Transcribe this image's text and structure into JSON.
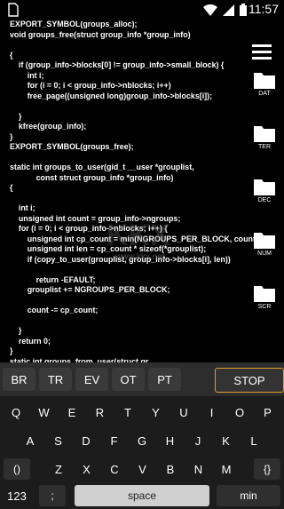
{
  "status": {
    "time": "11:57"
  },
  "code_lines": [
    "EXPORT_SYMBOL(groups_alloc);",
    "void groups_free(struct group_info *group_info)",
    "",
    "{",
    "    if (group_info->blocks[0] != group_info->small_block) {",
    "        int i;",
    "        for (i = 0; i < group_info->nblocks; i++)",
    "        free_page((unsigned long)group_info->blocks[i]);",
    "",
    "    }",
    "    kfree(group_info);",
    "}",
    "EXPORT_SYMBOL(groups_free);",
    "",
    "static int groups_to_user(gid_t __user *grouplist,",
    "            const struct group_info *group_info)",
    "{",
    "",
    "    int i;",
    "    unsigned int count = group_info->ngroups;",
    "    for (i = 0; i < group_info->nblocks; i++) {",
    "        unsigned int cp_count = min(NGROUPS_PER_BLOCK, count);",
    "        unsigned int len = cp_count * sizeof(*grouplist);",
    "        if (copy_to_user(grouplist, group_info->blocks[i], len))",
    "",
    "            return -EFAULT;",
    "        grouplist += NGROUPS_PER_BLOCK;",
    "",
    "        count -= cp_count;",
    "",
    "    }",
    "    return 0;",
    "}",
    "static int groups_from_user(struct gr"
  ],
  "sidebar": {
    "folders": [
      {
        "label": "DAT"
      },
      {
        "label": "TER"
      },
      {
        "label": "DEC"
      },
      {
        "label": "NUM"
      },
      {
        "label": "SCR"
      }
    ]
  },
  "watermark": {
    "text": "www.kkx.net"
  },
  "toolbar": {
    "buttons": [
      "BR",
      "TR",
      "EV",
      "OT",
      "PT"
    ],
    "stop_label": "STOP"
  },
  "keyboard": {
    "row1": [
      "Q",
      "W",
      "E",
      "R",
      "T",
      "Y",
      "U",
      "I",
      "O",
      "P"
    ],
    "row2": [
      "A",
      "S",
      "D",
      "F",
      "G",
      "H",
      "J",
      "K",
      "L"
    ],
    "row3_left": "()",
    "row3": [
      "Z",
      "X",
      "C",
      "V",
      "B",
      "N",
      "M"
    ],
    "row3_right": "{}",
    "num_label": "123",
    "semicolon_label": ";",
    "space_label": "space",
    "min_label": "min"
  }
}
